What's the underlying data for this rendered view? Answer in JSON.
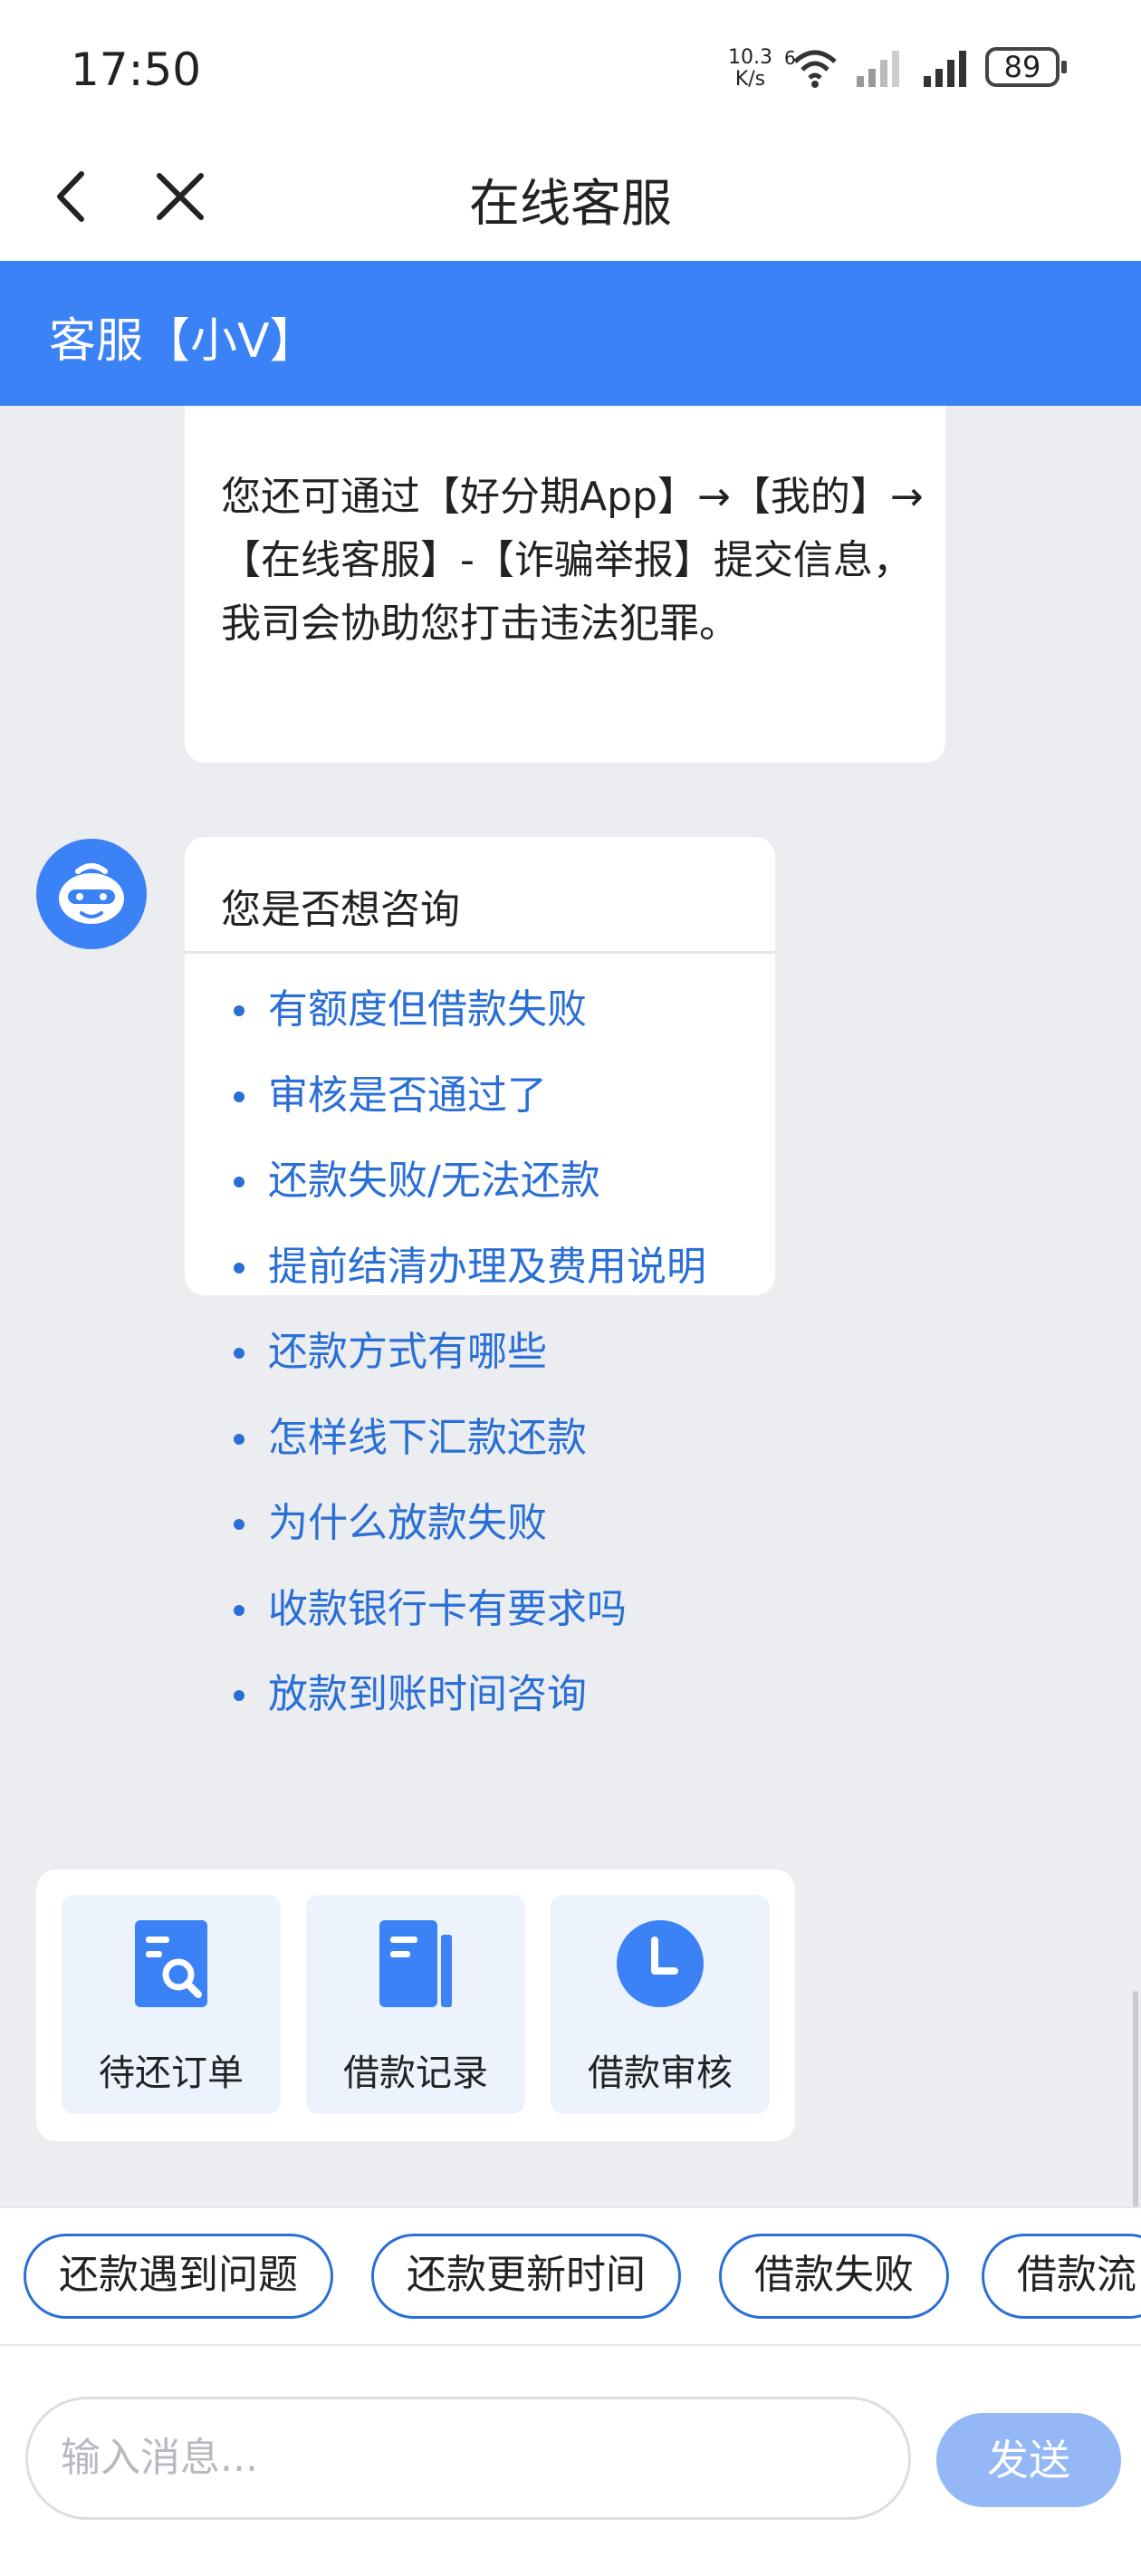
{
  "status_bar": {
    "time": "17:50",
    "net_speed_value": "10.3",
    "net_speed_unit": "K/s",
    "wifi_badge": "6",
    "battery": "89"
  },
  "nav": {
    "title": "在线客服"
  },
  "agent": {
    "name": "客服【小V】"
  },
  "messages": {
    "first_text": "您还可通过【好分期App】→【我的】→【在线客服】-【诈骗举报】提交信息，我司会协助您打击违法犯罪。",
    "question_title": "您是否想咨询",
    "questions": [
      "有额度但借款失败",
      "审核是否通过了",
      "还款失败/无法还款",
      "提前结清办理及费用说明",
      "还款方式有哪些",
      "怎样线下汇款还款",
      "为什么放款失败",
      "收款银行卡有要求吗",
      "放款到账时间咨询"
    ]
  },
  "quick_actions": [
    {
      "label": "待还订单",
      "icon": "order-search-icon"
    },
    {
      "label": "借款记录",
      "icon": "record-book-icon"
    },
    {
      "label": "借款审核",
      "icon": "clock-icon"
    }
  ],
  "chips": [
    "还款遇到问题",
    "还款更新时间",
    "借款失败",
    "借款流"
  ],
  "input": {
    "placeholder": "输入消息...",
    "send_label": "发送"
  },
  "colors": {
    "accent": "#3b82f6",
    "link": "#2a6fd6",
    "background": "#ebedf0",
    "send_disabled": "#93b8f5"
  }
}
